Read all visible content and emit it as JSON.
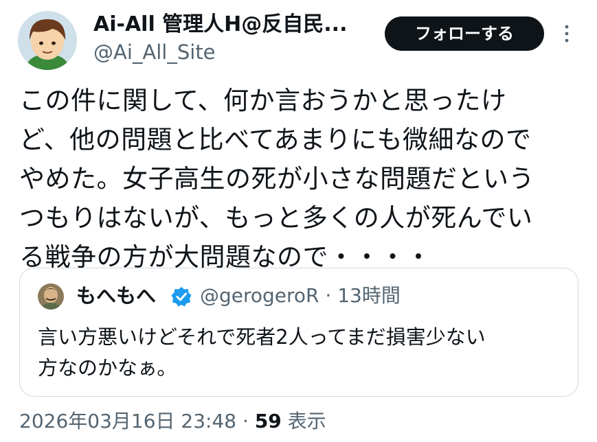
{
  "author": {
    "display_name": "Ai-All 管理人H@反自民...",
    "handle": "@Ai_All_Site",
    "avatar": "cartoon-man-avatar"
  },
  "follow_button_label": "フォローする",
  "more_icon": "more-vertical-icon",
  "tweet": {
    "text": "この件に関して、何か言おうかと思ったけ\nど、他の問題と比べてあまりにも微細なので\nやめた。女子高生の死が小さな問題だという\nつもりはないが、もっと多くの人が死んでい\nる戦争の方が大問題なので・・・・"
  },
  "quote": {
    "display_name": "もへもへ",
    "verified": true,
    "verified_icon": "verified-badge-icon",
    "handle": "@gerogeroR",
    "separator": "·",
    "time": "13時間",
    "text": "言い方悪いけどそれで死者2人ってまだ損害少ない\n方なのかなぁ。",
    "avatar": "portrait-avatar"
  },
  "meta": {
    "timestamp": "2026年03月16日 23:48",
    "separator": "·",
    "views_count": "59",
    "views_label": "表示"
  },
  "colors": {
    "text_primary": "#0f1419",
    "text_secondary": "#536471",
    "follow_bg": "#0f1419",
    "verified": "#1d9bf0",
    "border": "#cfd9de"
  }
}
